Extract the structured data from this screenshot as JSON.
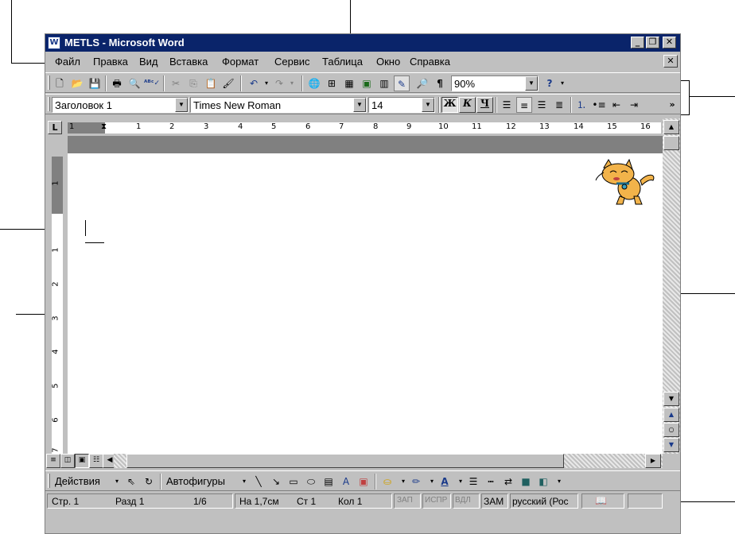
{
  "window": {
    "title": "METLS - Microsoft Word",
    "app_icon": "W",
    "minimize": "_",
    "restore": "❐",
    "close": "✕"
  },
  "menu": {
    "items": [
      "Файл",
      "Правка",
      "Вид",
      "Вставка",
      "Формат",
      "Сервис",
      "Таблица",
      "Окно",
      "Справка"
    ],
    "doc_close": "✕"
  },
  "standard_toolbar": {
    "icons": [
      "new-document-icon",
      "open-folder-icon",
      "save-disk-icon",
      "print-icon",
      "print-preview-icon",
      "spelling-icon",
      "cut-icon",
      "copy-icon",
      "paste-icon",
      "format-painter-icon",
      "undo-icon",
      "redo-icon",
      "hyperlink-icon",
      "tables-borders-icon",
      "insert-table-icon",
      "insert-excel-icon",
      "columns-icon",
      "drawing-icon",
      "document-map-icon",
      "show-formatting-icon",
      "help-icon"
    ],
    "zoom": "90%"
  },
  "formatting_toolbar": {
    "style": "Заголовок 1",
    "font": "Times New Roman",
    "size": "14",
    "bold": "Ж",
    "italic": "К",
    "underline": "Ч",
    "more": "»"
  },
  "ruler": {
    "tab_selector": "L",
    "numbers": [
      "1",
      "1",
      "2",
      "3",
      "4",
      "5",
      "6",
      "7",
      "8",
      "9",
      "10",
      "11",
      "12",
      "13",
      "14",
      "15",
      "16"
    ]
  },
  "vertical_ruler": {
    "numbers": [
      "1",
      "1",
      "2",
      "3",
      "4",
      "5",
      "6",
      "7"
    ]
  },
  "drawing_toolbar": {
    "actions": "Действия",
    "autoshapes": "Автофигуры"
  },
  "status_bar": {
    "page": "Стр. 1",
    "section": "Разд 1",
    "pages": "1/6",
    "position": "На 1,7см",
    "line": "Ст 1",
    "column": "Кол 1",
    "rec": "ЗАП",
    "track": "ИСПР",
    "extend": "ВДЛ",
    "overtype": "ЗАМ",
    "language": "русский (Рос"
  }
}
